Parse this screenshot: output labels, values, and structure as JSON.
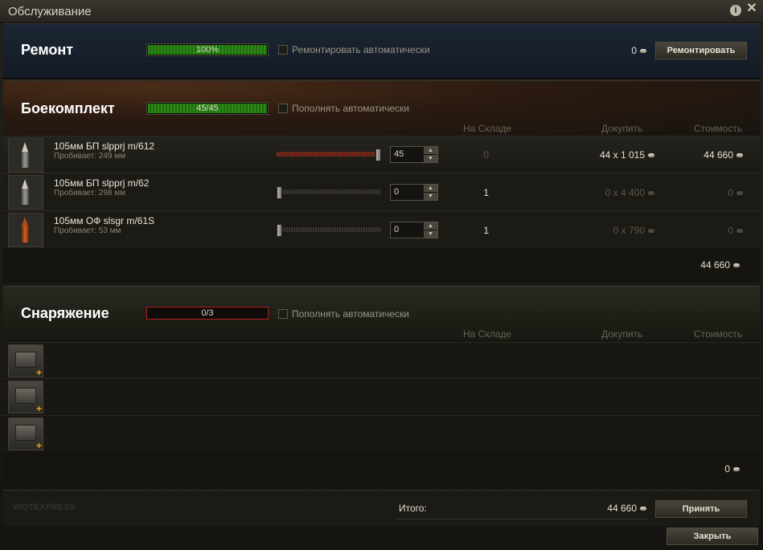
{
  "window": {
    "title": "Обслуживание",
    "info_glyph": "i",
    "close_glyph": "✕"
  },
  "repair": {
    "title": "Ремонт",
    "progress_label": "100%",
    "progress": 1.0,
    "auto_label": "Ремонтировать автоматически",
    "cost": "0",
    "button": "Ремонтировать"
  },
  "ammo": {
    "title": "Боекомплект",
    "progress_label": "45/45",
    "progress": 1.0,
    "auto_label": "Пополнять автоматически",
    "columns": {
      "stock": "На Складе",
      "buy": "Докупить",
      "cost": "Стоимость"
    },
    "items": [
      {
        "name": "105мм БП slpprj m/612",
        "pen": "Пробивает: 249 мм",
        "value": "45",
        "slider": 1.0,
        "stock": "0",
        "buy": "44 x 1 015",
        "cost": "44 660"
      },
      {
        "name": "105мм БП slpprj m/62",
        "pen": "Пробивает: 298 мм",
        "value": "0",
        "slider": 0.0,
        "stock": "1",
        "buy": "0 x 4 400",
        "cost": "0"
      },
      {
        "name": "105мм ОФ slsgr m/61S",
        "pen": "Пробивает: 53 мм",
        "value": "0",
        "slider": 0.0,
        "stock": "1",
        "buy": "0 x 790",
        "cost": "0"
      }
    ],
    "subtotal": "44 660"
  },
  "equipment": {
    "title": "Снаряжение",
    "progress_label": "0/3",
    "progress": 0.0,
    "auto_label": "Пополнять автоматически",
    "columns": {
      "stock": "На Складе",
      "buy": "Докупить",
      "cost": "Стоимость"
    },
    "subtotal": "0"
  },
  "footer": {
    "watermark": "WOTEXPRESS",
    "total_label": "Итого:",
    "total": "44 660",
    "accept_button": "Принять",
    "close_button": "Закрыть"
  },
  "colors": {
    "progress_green": "#2e8b17",
    "progress_red_border": "#b51a1a",
    "accent_orange": "#f0a020"
  }
}
